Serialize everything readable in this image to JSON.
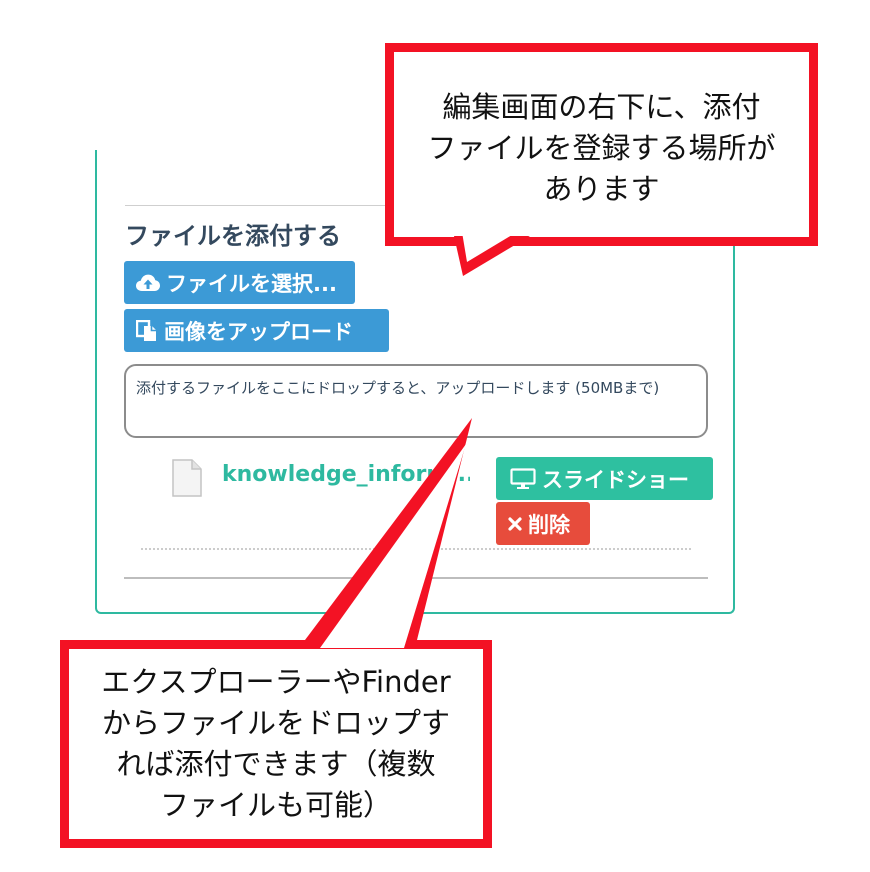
{
  "attach_section": {
    "title": "ファイルを添付する",
    "choose_file_label": "ファイルを選択...",
    "upload_image_label": "画像をアップロード",
    "dropzone_text": "添付するファイルをここにドロップすると、アップロードします (50MBまで)"
  },
  "file_list": [
    {
      "name": "knowledge_inform...",
      "icon": "file-icon",
      "slideshow_label": "スライドショー",
      "delete_label": "削除"
    }
  ],
  "callouts": {
    "top_text": "編集画面の右下に、添付\nファイルを登録する場所が\nあります",
    "bottom_text": "エクスプローラーやFinder\nからファイルをドロップす\nれば添付できます（複数\nファイルも可能）"
  },
  "colors": {
    "accent_teal": "#2eb9a0",
    "button_blue": "#3c9ad6",
    "button_red": "#e74c3c",
    "callout_red": "#f31224"
  }
}
